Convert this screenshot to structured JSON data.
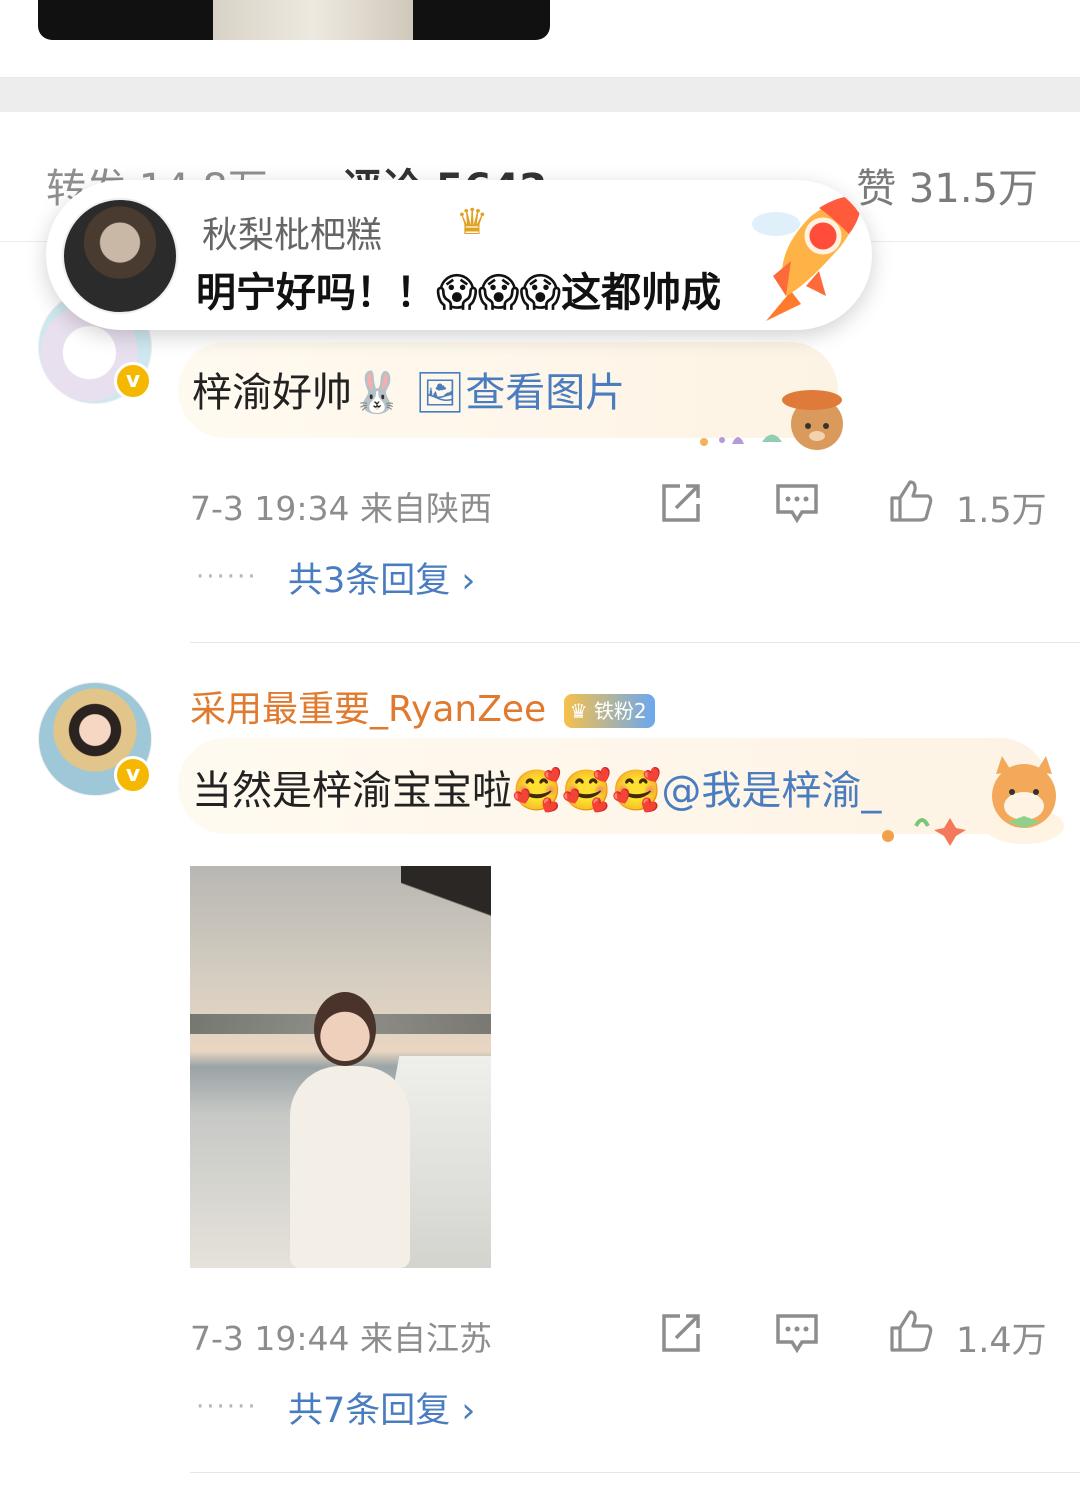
{
  "stats": {
    "repost": "转发 14.8万",
    "comment": "评论 5642",
    "like": "赞 31.5万"
  },
  "popup": {
    "name": "秋梨枇杷糕",
    "text": "明宁好吗！！😱😱😱这都帅成"
  },
  "comments": [
    {
      "text": "梓渝好帅🐰",
      "link": "🖼查看图片",
      "meta": "7-3 19:34  来自陕西",
      "likes": "1.5万",
      "dots": "······",
      "replies": "共3条回复 ›"
    },
    {
      "name": "采用最重要_RyanZee",
      "badge": "铁粉2",
      "text": "当然是梓渝宝宝啦🥰🥰🥰",
      "mention": "@我是梓渝_",
      "meta": "7-3 19:44  来自江苏",
      "likes": "1.4万",
      "dots": "······",
      "replies": "共7条回复 ›"
    }
  ],
  "icons": {
    "share": "share-icon",
    "comment": "comment-icon",
    "like": "thumbs-up-icon"
  },
  "colors": {
    "link": "#4a7cc0",
    "fan_name": "#e07a2e",
    "verified": "#f5b800"
  }
}
